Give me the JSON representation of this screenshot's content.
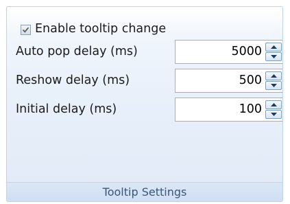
{
  "group": {
    "title": "Tooltip Settings",
    "enable_checkbox": {
      "label": "Enable tooltip change",
      "checked": true
    },
    "fields": [
      {
        "label": "Auto pop delay (ms)",
        "value": "5000"
      },
      {
        "label": "Reshow delay (ms)",
        "value": "500"
      },
      {
        "label": "Initial delay (ms)",
        "value": "100"
      }
    ]
  },
  "icons": {
    "check": "checkmark-icon",
    "spin_up": "arrow-up-icon",
    "spin_down": "arrow-down-icon"
  }
}
